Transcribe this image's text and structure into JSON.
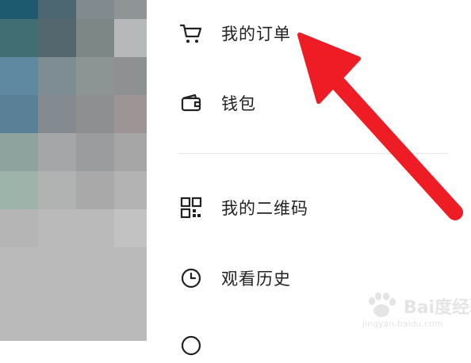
{
  "menu": {
    "items": [
      {
        "label": "我的订单",
        "icon": "cart-icon"
      },
      {
        "label": "钱包",
        "icon": "wallet-icon"
      },
      {
        "label": "我的二维码",
        "icon": "qr-code-icon"
      },
      {
        "label": "观看历史",
        "icon": "clock-icon"
      }
    ]
  },
  "colors": {
    "arrow": "#ee1c25",
    "text": "#222222",
    "divider": "#e6e6e6"
  },
  "watermark": {
    "brand": "Bai度经验",
    "url": "jingyan.baidu.com"
  }
}
